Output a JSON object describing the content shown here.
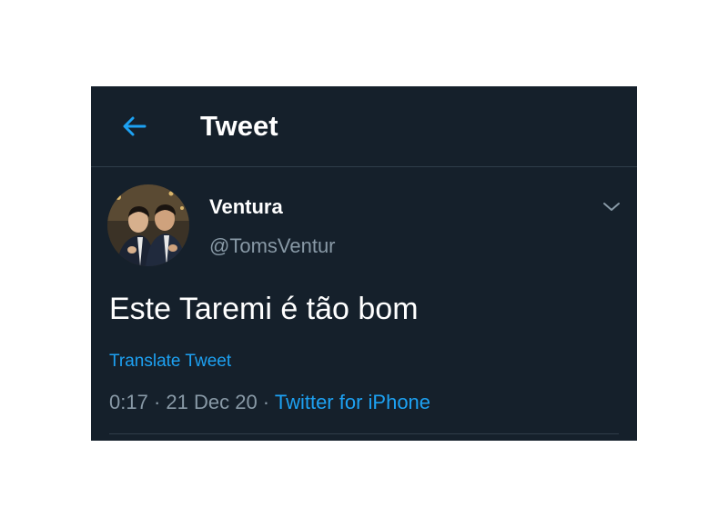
{
  "header": {
    "back_icon": "arrow-left-icon",
    "title": "Tweet"
  },
  "tweet": {
    "author_name": "Ventura",
    "author_handle": "@TomsVentur",
    "text": "Este Taremi é tão bom",
    "translate_label": "Translate Tweet",
    "time": "0:17",
    "date": "21 Dec 20",
    "source": "Twitter for iPhone",
    "separator": " · ",
    "more_icon": "chevron-down-icon"
  },
  "colors": {
    "background": "#15202b",
    "accent": "#1da1f2",
    "secondary_text": "#8899a6",
    "divider": "#2f3d4a"
  }
}
